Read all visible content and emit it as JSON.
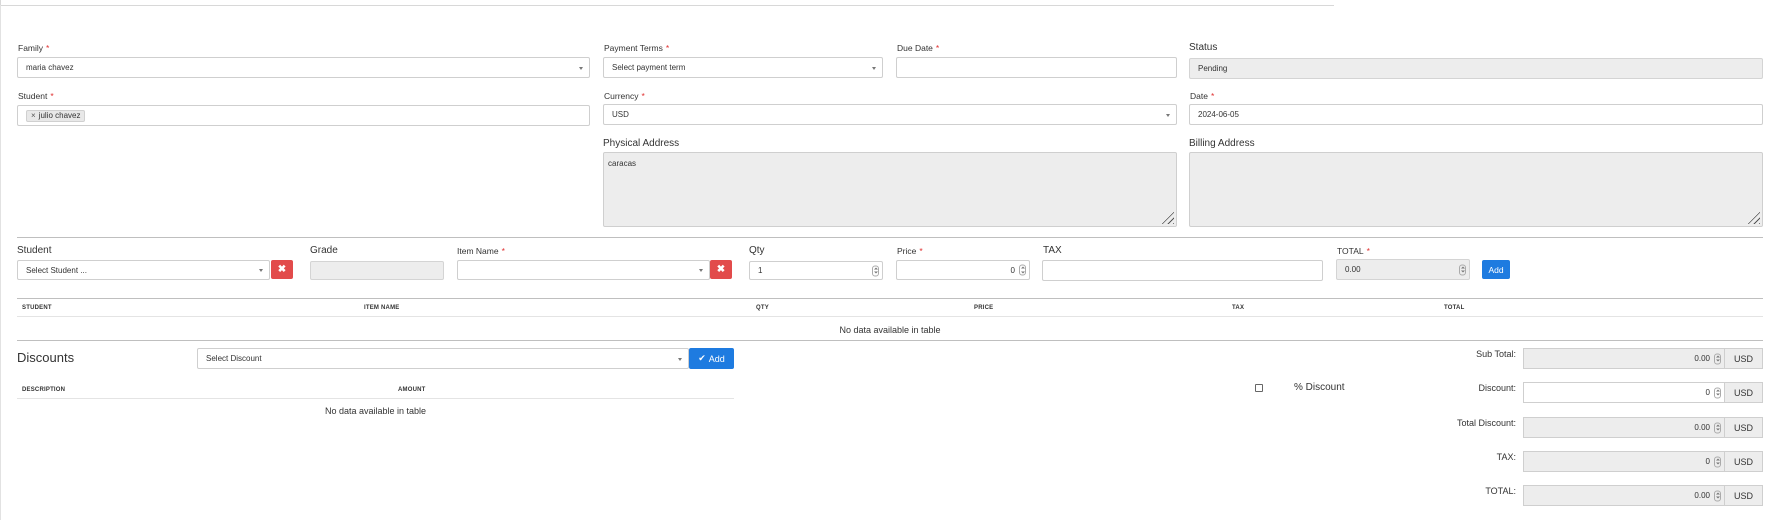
{
  "form": {
    "family": {
      "label": "Family",
      "value": "maria chavez"
    },
    "payment_terms": {
      "label": "Payment Terms",
      "placeholder": "Select payment term"
    },
    "due_date": {
      "label": "Due Date",
      "value": ""
    },
    "status": {
      "label": "Status",
      "value": "Pending"
    },
    "student": {
      "label": "Student",
      "tag": "julio chavez",
      "tag_remove": "×"
    },
    "currency": {
      "label": "Currency",
      "value": "USD"
    },
    "date": {
      "label": "Date",
      "value": "2024-06-05"
    },
    "physical_address": {
      "label": "Physical Address",
      "value": "caracas"
    },
    "billing_address": {
      "label": "Billing Address",
      "value": ""
    },
    "required_marker": "*"
  },
  "line_entry": {
    "student": {
      "label": "Student",
      "placeholder": "Select Student ..."
    },
    "grade": {
      "label": "Grade",
      "value": ""
    },
    "item_name": {
      "label": "Item Name",
      "value": ""
    },
    "qty": {
      "label": "Qty",
      "value": "1"
    },
    "price": {
      "label": "Price",
      "value": "0"
    },
    "tax": {
      "label": "TAX",
      "value": ""
    },
    "total": {
      "label": "TOTAL",
      "value": "0.00"
    },
    "clear_icon": "✖",
    "add_label": "Add"
  },
  "items_table": {
    "columns": [
      "STUDENT",
      "ITEM NAME",
      "QTY",
      "PRICE",
      "TAX",
      "TOTAL"
    ],
    "empty_text": "No data available in table"
  },
  "discounts": {
    "title": "Discounts",
    "select_placeholder": "Select Discount",
    "add_label": "Add",
    "add_icon": "✔",
    "columns": [
      "DESCRIPTION",
      "AMOUNT"
    ],
    "empty_text": "No data available in table",
    "percent_label": "% Discount"
  },
  "summary": {
    "sub_total": {
      "label": "Sub Total:",
      "value": "0.00",
      "currency": "USD"
    },
    "discount": {
      "label": "Discount:",
      "value": "0",
      "currency": "USD"
    },
    "total_discount": {
      "label": "Total Discount:",
      "value": "0.00",
      "currency": "USD"
    },
    "tax": {
      "label": "TAX:",
      "value": "0",
      "currency": "USD"
    },
    "total": {
      "label": "TOTAL:",
      "value": "0.00",
      "currency": "USD"
    }
  },
  "colors": {
    "accent": "#1e7be0",
    "danger": "#e24b4b",
    "required": "#e03030",
    "readonly_bg": "#ededed"
  }
}
